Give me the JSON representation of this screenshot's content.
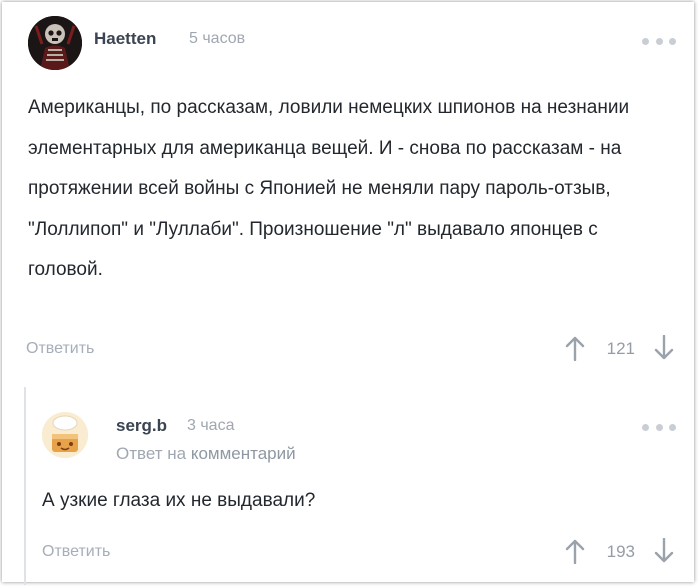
{
  "comments": [
    {
      "author": "Haetten",
      "time": "5 часов",
      "text": "Американцы, по рассказам, ловили немецких шпионов на незнании элементарных для американца вещей. И - снова по рассказам - на протяжении всей войны с Японией не меняли пару пароль-отзыв, \"Лоллипоп\" и \"Луллаби\". Произношение \"л\" выдавало японцев с головой.",
      "reply_label": "Ответить",
      "rating": "121",
      "avatar_icon": "dark-skeleton-avatar-icon"
    },
    {
      "author": "serg.b",
      "time": "3 часа",
      "reply_to_prefix": "Ответ на",
      "reply_to_target": "комментарий",
      "text": "А узкие глаза их не выдавали?",
      "reply_label": "Ответить",
      "rating": "193",
      "avatar_icon": "chef-cake-avatar-icon"
    }
  ],
  "icons": {
    "more": "more-dots-icon",
    "upvote": "arrow-up-icon",
    "downvote": "arrow-down-icon"
  },
  "colors": {
    "text": "#23282e",
    "muted": "#a0a7b0",
    "author": "#3b4452"
  }
}
